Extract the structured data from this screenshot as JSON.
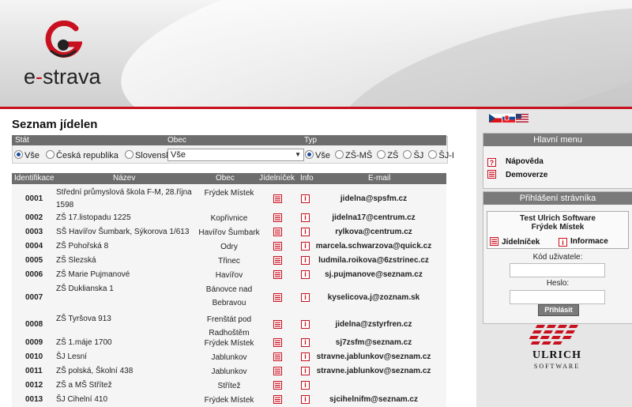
{
  "header": {
    "logo_prefix": "e",
    "logo_dash": "-",
    "logo_suffix": "strava"
  },
  "page_title": "Seznam jídelen",
  "filters": {
    "stat_label": "Stát",
    "obec_label": "Obec",
    "typ_label": "Typ",
    "stat_options": [
      "Vše",
      "Česká republika",
      "Slovensko"
    ],
    "stat_selected": "Vše",
    "obec_value": "Vše",
    "typ_options": [
      "Vše",
      "ZŠ-MŠ",
      "ZŠ",
      "ŠJ",
      "ŠJ-I"
    ],
    "typ_selected": "Vše"
  },
  "table": {
    "headers": [
      "Identifikace",
      "Název",
      "Obec",
      "Jídelníček",
      "Info",
      "E-mail"
    ],
    "rows": [
      {
        "id": "0001",
        "name": "Střední průmyslová škola F-M, 28.října 1598",
        "obec": "Frýdek Místek",
        "email": "jidelna@spsfm.cz"
      },
      {
        "id": "0002",
        "name": "ZŠ 17.listopadu 1225",
        "obec": "Kopřivnice",
        "email": "jidelna17@centrum.cz"
      },
      {
        "id": "0003",
        "name": "SŠ Havířov Šumbark, Sýkorova 1/613",
        "obec": "Havířov Šumbark",
        "email": "rylkova@centrum.cz"
      },
      {
        "id": "0004",
        "name": "ZŠ Pohořská 8",
        "obec": "Odry",
        "email": "marcela.schwarzova@quick.cz"
      },
      {
        "id": "0005",
        "name": "ZŠ Slezská",
        "obec": "Třinec",
        "email": "ludmila.roikova@6zstrinec.cz"
      },
      {
        "id": "0006",
        "name": "ZŠ Marie Pujmanové",
        "obec": "Havířov",
        "email": "sj.pujmanove@seznam.cz"
      },
      {
        "id": "0007",
        "name": "ZŠ Duklianska 1",
        "obec": "Bánovce nad Bebravou",
        "email": "kyselicova.j@zoznam.sk"
      },
      {
        "id": "0008",
        "name": "ZŠ Tyršova 913",
        "obec": "Frenštát pod Radhoštěm",
        "email": "jidelna@zstyrfren.cz"
      },
      {
        "id": "0009",
        "name": "ZŠ 1.máje 1700",
        "obec": "Frýdek Místek",
        "email": "sj7zsfm@seznam.cz"
      },
      {
        "id": "0010",
        "name": "ŠJ Lesní",
        "obec": "Jablunkov",
        "email": "stravne.jablunkov@seznam.cz"
      },
      {
        "id": "0011",
        "name": "ZŠ polská, Školní 438",
        "obec": "Jablunkov",
        "email": "stravne.jablunkov@seznam.cz"
      },
      {
        "id": "0012",
        "name": "ZŠ a MŠ Střítež",
        "obec": "Střítež",
        "email": ""
      },
      {
        "id": "0013",
        "name": "ŠJ Cihelní 410",
        "obec": "Frýdek Místek",
        "email": "sjcihelnifm@seznam.cz"
      }
    ]
  },
  "sidebar": {
    "main_menu_title": "Hlavní menu",
    "menu_items": [
      "Nápověda",
      "Demoverze"
    ],
    "login_title": "Přihlášení strávníka",
    "org_line1": "Test Ulrich Software",
    "org_line2": "Frýdek Místek",
    "link_menu": "Jídelníček",
    "link_info": "Informace",
    "user_label": "Kód uživatele:",
    "password_label": "Heslo:",
    "login_button": "Přihlásit",
    "brand_name": "ULRICH",
    "brand_sub": "SOFTWARE"
  },
  "colors": {
    "accent_red": "#c8101e",
    "header_gray": "#6d6d6d"
  }
}
